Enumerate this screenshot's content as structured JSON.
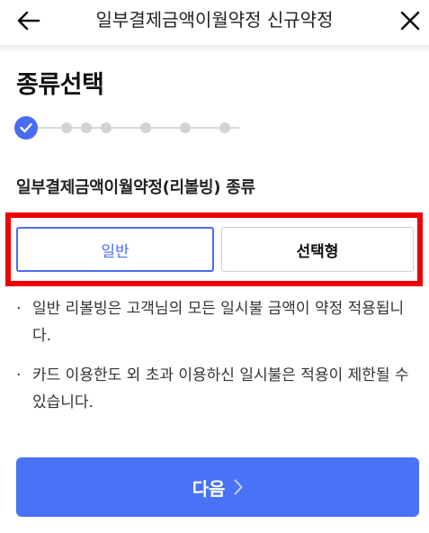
{
  "header": {
    "title": "일부결제금액이월약정 신규약정",
    "back_icon": "arrow-left-icon",
    "close_icon": "close-icon"
  },
  "page": {
    "title": "종류선택"
  },
  "stepper": {
    "current_step": 1,
    "total_steps": 6,
    "active_color": "#4a6cf7"
  },
  "section": {
    "label": "일부결제금액이월약정(리볼빙) 종류"
  },
  "options": {
    "general": "일반",
    "selective": "선택형",
    "selected": "일반"
  },
  "info": {
    "items": [
      "일반 리볼빙은 고객님의 모든 일시불 금액이 약정 적용됩니다.",
      "카드 이용한도 외 초과 이용하신 일시불은 적용이 제한될 수 있습니다."
    ]
  },
  "footer": {
    "next_label": "다음",
    "next_icon": "chevron-right-icon",
    "accent": "#4a72f7"
  },
  "annotation": {
    "highlight_color": "#ee0000"
  }
}
